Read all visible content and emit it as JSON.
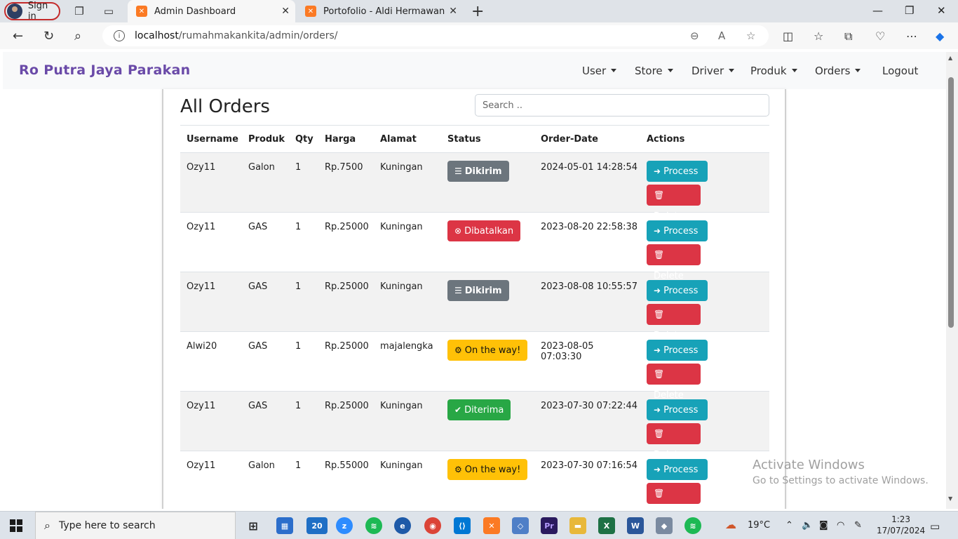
{
  "browser": {
    "profile_label": "Sign in",
    "tabs": [
      {
        "title": "Admin Dashboard",
        "active": true
      },
      {
        "title": "Portofolio - Aldi Hermawan",
        "active": false
      }
    ],
    "url_host": "localhost",
    "url_path": "/rumahmakankita/admin/orders/"
  },
  "navbar": {
    "brand": "Ro Putra Jaya Parakan",
    "menu": [
      "User",
      "Store",
      "Driver",
      "Produk",
      "Orders"
    ],
    "logout": "Logout"
  },
  "main": {
    "title": "All Orders",
    "search_placeholder": "Search ..",
    "columns": [
      "Username",
      "Produk",
      "Qty",
      "Harga",
      "Alamat",
      "Status",
      "Order-Date",
      "Actions"
    ],
    "process_label": "Process",
    "delete_label": "Delete",
    "rows": [
      {
        "username": "Ozy11",
        "produk": "Galon",
        "qty": "1",
        "harga": "Rp.7500",
        "alamat": "Kuningan",
        "status": "Dikirim",
        "date": "2024-05-01 14:28:54"
      },
      {
        "username": "Ozy11",
        "produk": "GAS",
        "qty": "1",
        "harga": "Rp.25000",
        "alamat": "Kuningan",
        "status": "Dibatalkan",
        "date": "2023-08-20 22:58:38"
      },
      {
        "username": "Ozy11",
        "produk": "GAS",
        "qty": "1",
        "harga": "Rp.25000",
        "alamat": "Kuningan",
        "status": "Dikirim",
        "date": "2023-08-08 10:55:57"
      },
      {
        "username": "Alwi20",
        "produk": "GAS",
        "qty": "1",
        "harga": "Rp.25000",
        "alamat": "majalengka",
        "status": "On the way!",
        "date": "2023-08-05 07:03:30"
      },
      {
        "username": "Ozy11",
        "produk": "GAS",
        "qty": "1",
        "harga": "Rp.25000",
        "alamat": "Kuningan",
        "status": "Diterima",
        "date": "2023-07-30 07:22:44"
      },
      {
        "username": "Ozy11",
        "produk": "Galon",
        "qty": "1",
        "harga": "Rp.55000",
        "alamat": "Kuningan",
        "status": "On the way!",
        "date": "2023-07-30 07:16:54"
      }
    ]
  },
  "watermark": {
    "line1": "Activate Windows",
    "line2": "Go to Settings to activate Windows."
  },
  "taskbar": {
    "search_placeholder": "Type here to search",
    "weather": "19°C",
    "time": "1:23",
    "date": "17/07/2024",
    "badge_count": "20"
  },
  "colors": {
    "brand": "#6a4aa8",
    "process": "#17a2b8",
    "delete": "#dc3545",
    "dikirim": "#6c757d",
    "batal": "#dc3545",
    "way": "#ffc107",
    "terima": "#28a745"
  }
}
